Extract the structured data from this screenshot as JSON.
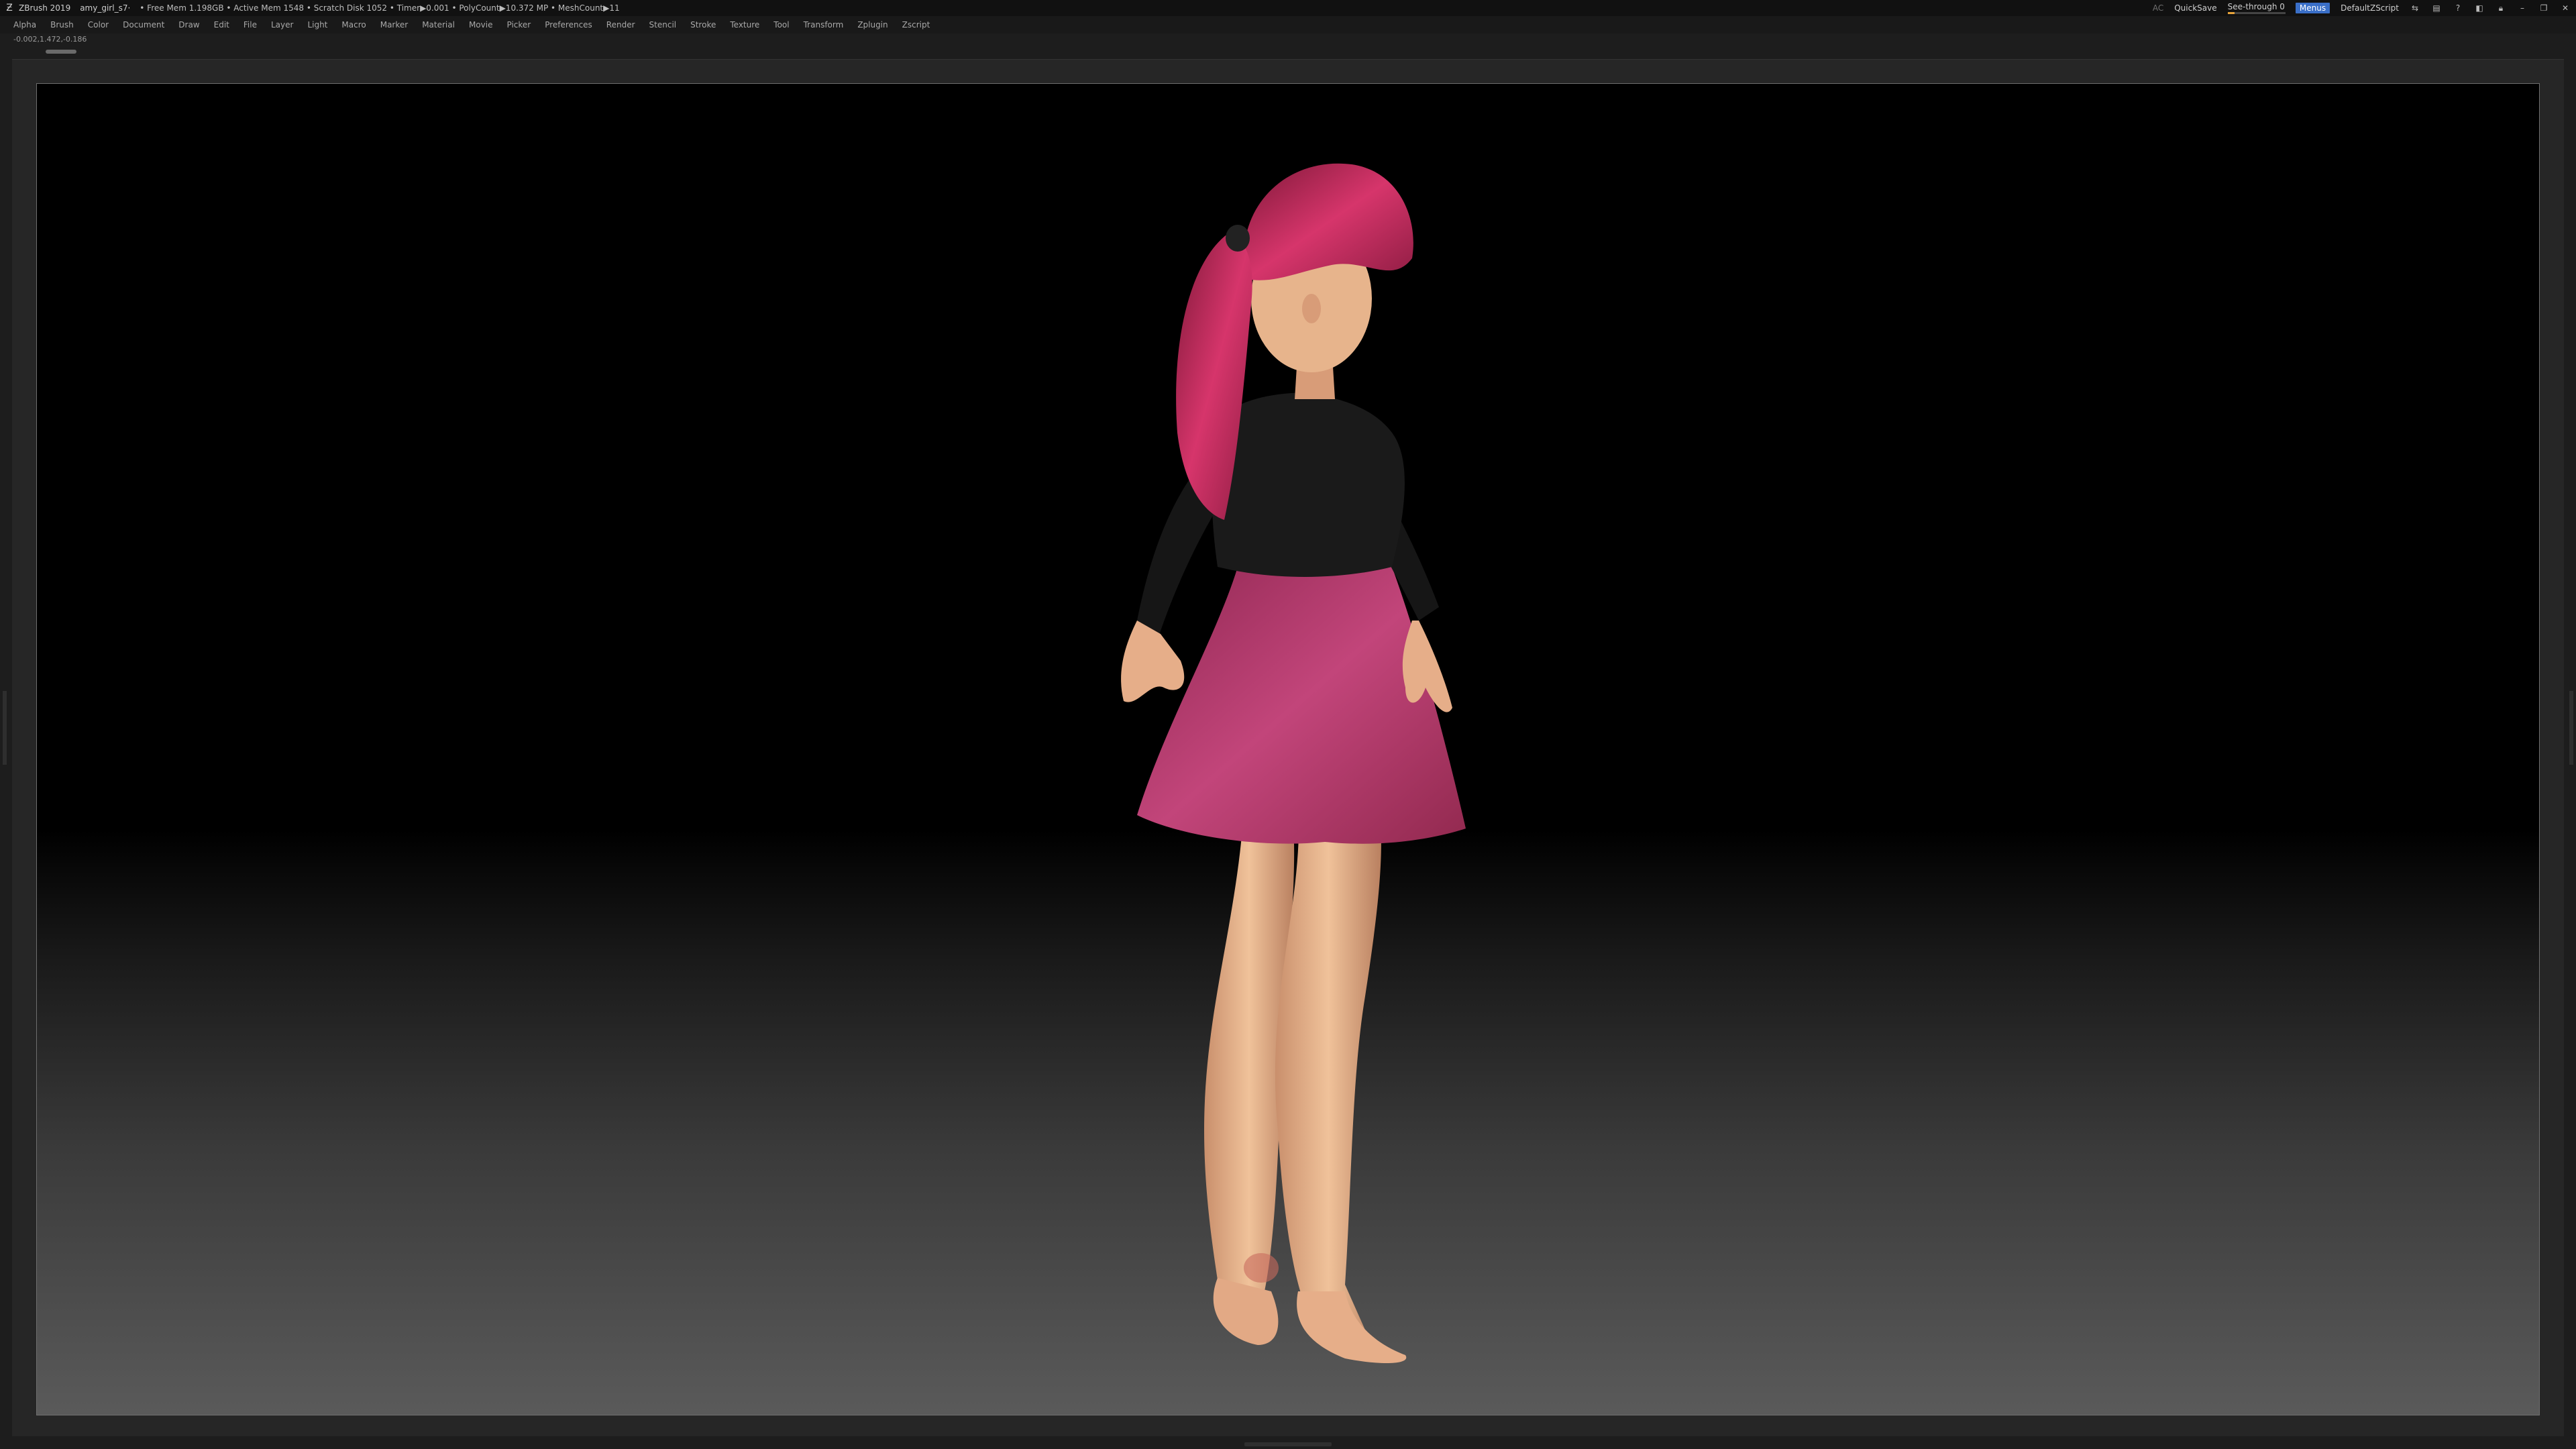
{
  "titlebar": {
    "app": "ZBrush 2019",
    "file": "amy_girl_s7·",
    "stats": "• Free Mem 1.198GB • Active Mem 1548 • Scratch Disk 1052 • Timer▶0.001 • PolyCount▶10.372 MP • MeshCount▶11",
    "ac": "AC",
    "quicksave": "QuickSave",
    "seethrough": "See-through 0",
    "menus": "Menus",
    "script": "DefaultZScript"
  },
  "menubar": {
    "items": [
      "Alpha",
      "Brush",
      "Color",
      "Document",
      "Draw",
      "Edit",
      "File",
      "Layer",
      "Light",
      "Macro",
      "Marker",
      "Material",
      "Movie",
      "Picker",
      "Preferences",
      "Render",
      "Stencil",
      "Stroke",
      "Texture",
      "Tool",
      "Transform",
      "Zplugin",
      "Zscript"
    ]
  },
  "coords": "-0.002,1.472,-0.186",
  "colors": {
    "hair": "#c2305e",
    "shirt": "#1a1a1a",
    "skirt": "#b53a6c",
    "skin": "#e7b48c",
    "menus_accent": "#3a6fc8"
  }
}
